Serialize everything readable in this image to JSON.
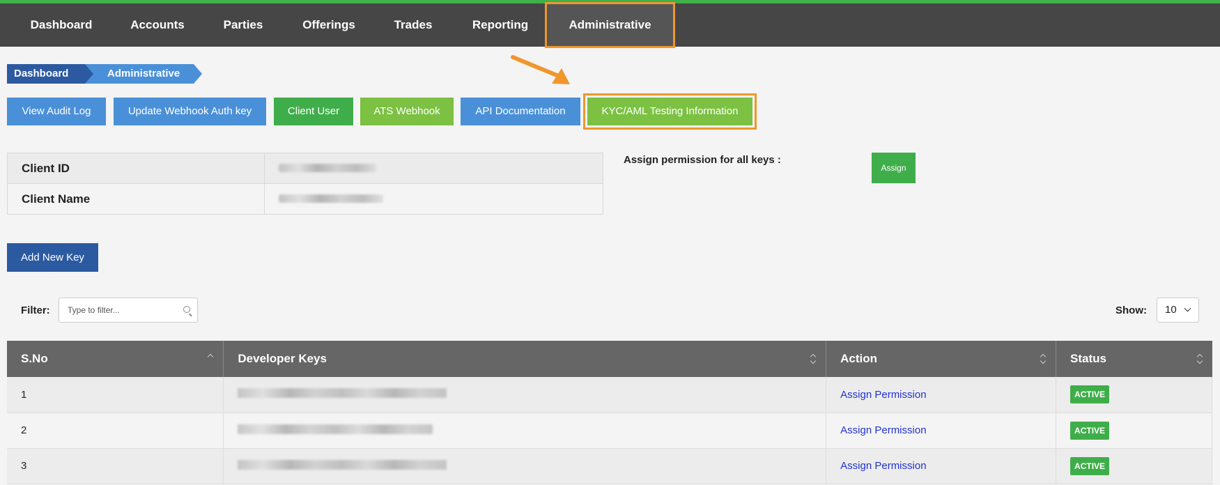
{
  "nav": {
    "items": [
      "Dashboard",
      "Accounts",
      "Parties",
      "Offerings",
      "Trades",
      "Reporting",
      "Administrative"
    ],
    "active": "Administrative"
  },
  "breadcrumb": [
    "Dashboard",
    "Administrative"
  ],
  "actions": {
    "view_audit_log": "View Audit Log",
    "update_webhook": "Update Webhook Auth key",
    "client_user": "Client User",
    "ats_webhook": "ATS Webhook",
    "api_docs": "API Documentation",
    "kyc_aml": "KYC/AML Testing Information"
  },
  "client": {
    "id_label": "Client ID",
    "name_label": "Client Name"
  },
  "assign": {
    "label": "Assign permission for all keys :",
    "button": "Assign"
  },
  "add_key": "Add New Key",
  "filter": {
    "label": "Filter:",
    "placeholder": "Type to filter..."
  },
  "show": {
    "label": "Show:",
    "value": "10"
  },
  "table": {
    "headers": [
      "S.No",
      "Developer Keys",
      "Action",
      "Status"
    ],
    "rows": [
      {
        "sno": "1",
        "action": "Assign Permission",
        "status": "ACTIVE"
      },
      {
        "sno": "2",
        "action": "Assign Permission",
        "status": "ACTIVE"
      },
      {
        "sno": "3",
        "action": "Assign Permission",
        "status": "ACTIVE"
      }
    ]
  },
  "colors": {
    "nav_bg": "#464646",
    "highlight": "#f0962c",
    "blue": "#4a90d9",
    "dark_blue": "#2c5aa0",
    "green": "#3fae4a",
    "light_green": "#7cc142"
  }
}
